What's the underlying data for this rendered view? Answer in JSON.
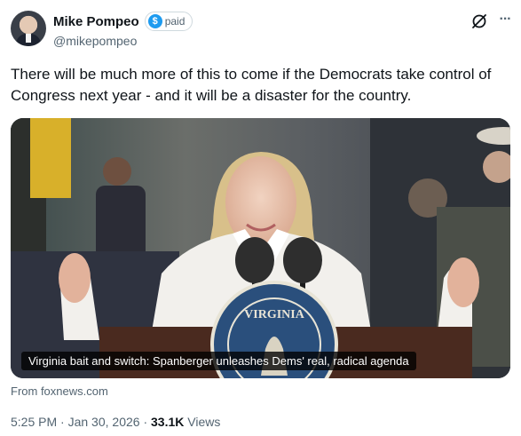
{
  "author": {
    "name": "Mike Pompeo",
    "handle": "@mikepompeo",
    "badge_symbol": "$",
    "badge_label": "paid",
    "badge_color": "#1d9bf0"
  },
  "header_icons": [
    "grok-icon",
    "more-icon"
  ],
  "post": {
    "text": "There will be much more of this to come if the Democrats take control of Congress next year - and it will be a disaster for the country."
  },
  "media": {
    "caption": "Virginia bait and switch: Spanberger unleashes Dems' real, radical agenda",
    "seal_text": "VIRGINIA",
    "source": "From foxnews.com"
  },
  "meta": {
    "time": "5:25 PM",
    "sep1": "·",
    "date": "Jan 30, 2026",
    "sep2": "·",
    "views_count": "33.1K",
    "views_label": "Views"
  },
  "colors": {
    "text": "#0f1419",
    "secondary": "#536471",
    "accent": "#1d9bf0",
    "seal_blue": "#2a4f7c",
    "podium": "#4a2a1f"
  }
}
